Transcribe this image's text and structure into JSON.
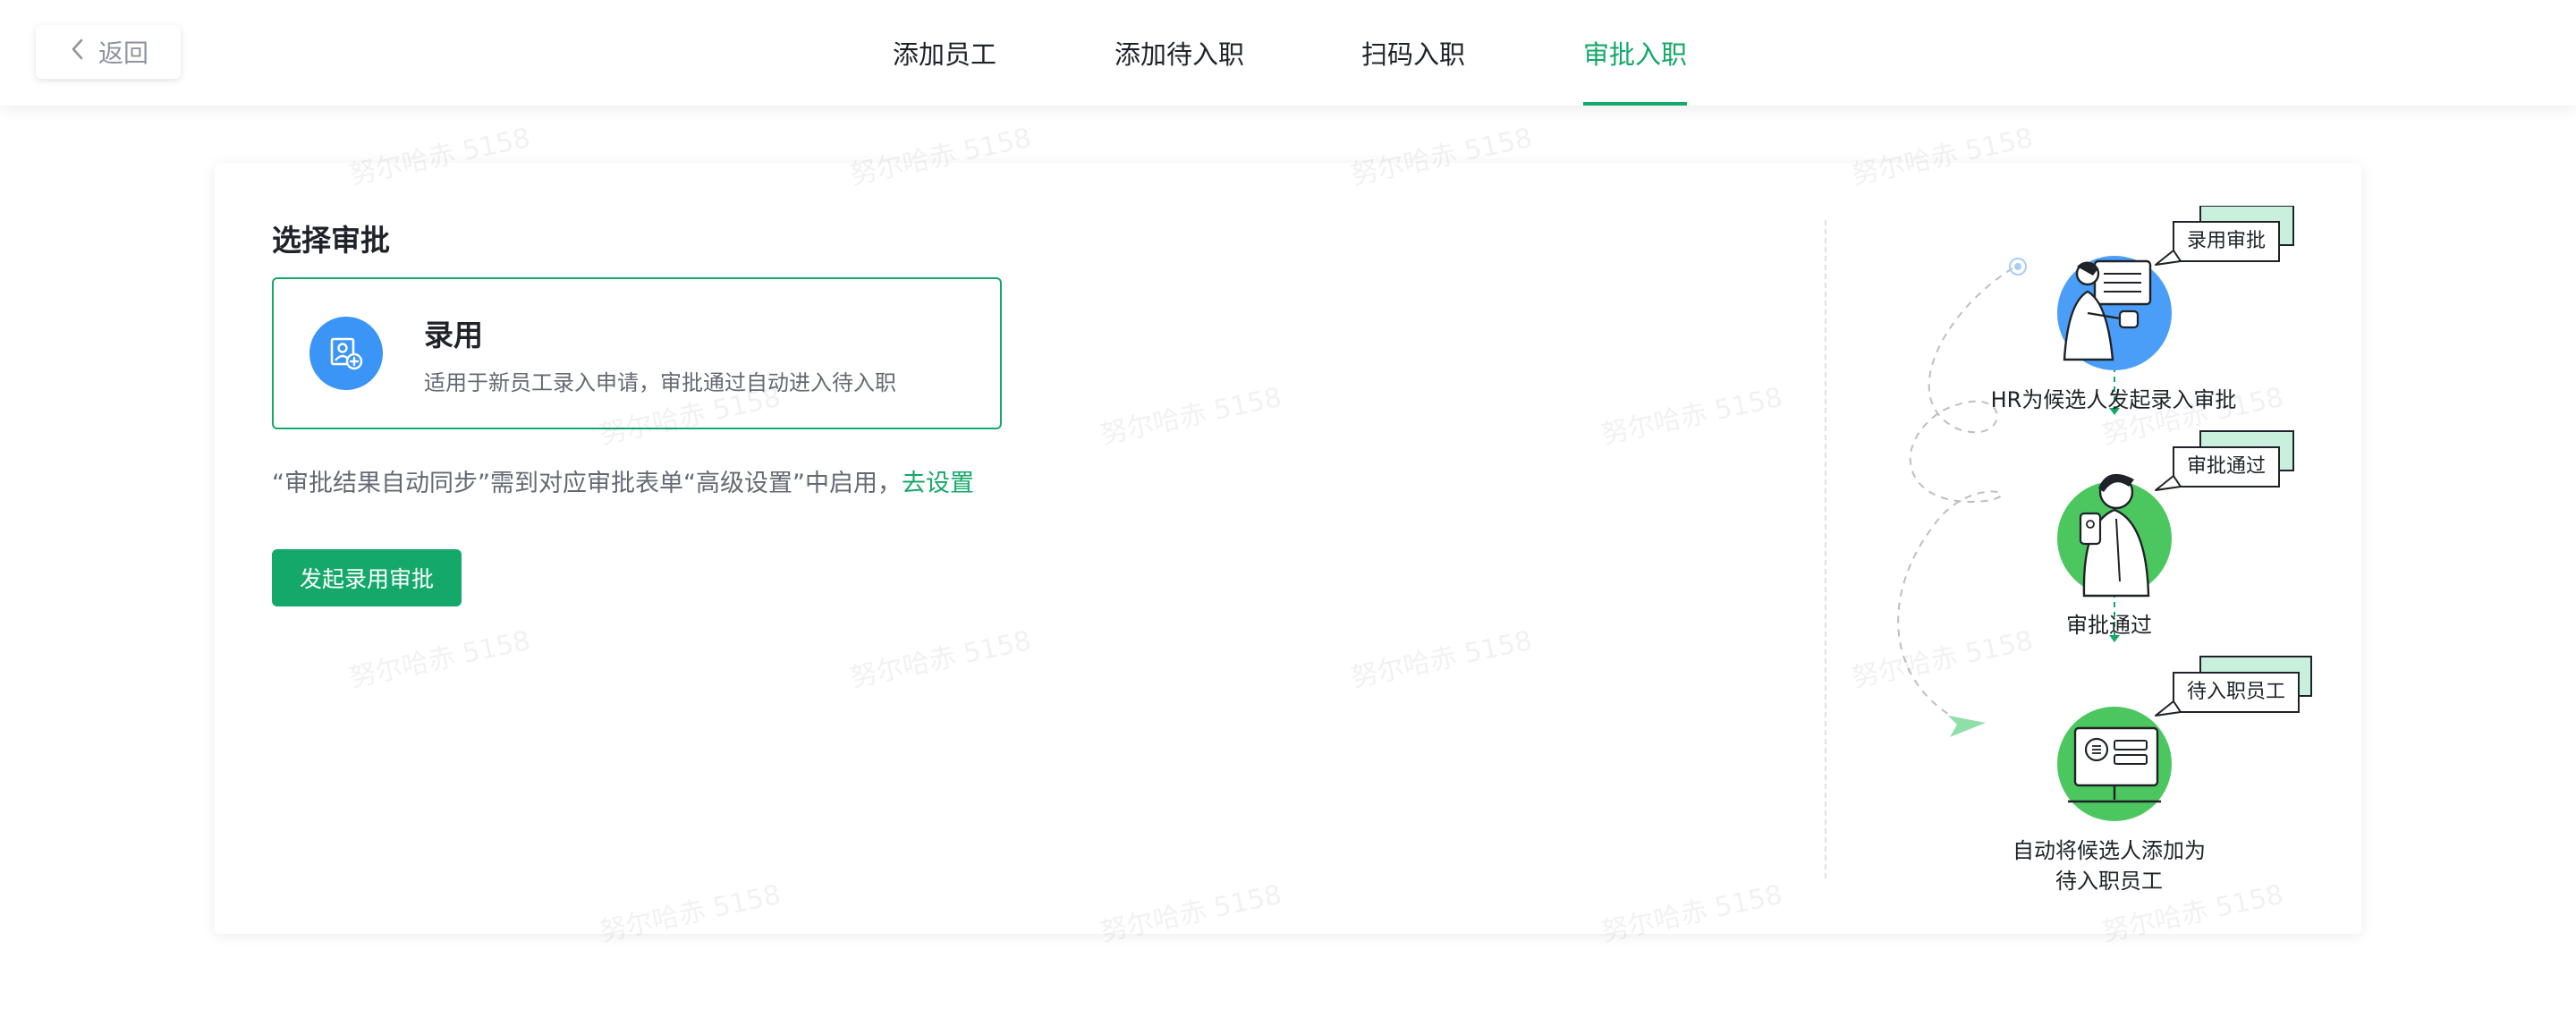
{
  "header": {
    "back_label": "返回",
    "tabs": [
      {
        "label": "添加员工",
        "active": false
      },
      {
        "label": "添加待入职",
        "active": false
      },
      {
        "label": "扫码入职",
        "active": false
      },
      {
        "label": "审批入职",
        "active": true
      }
    ]
  },
  "main": {
    "section_title": "选择审批",
    "option": {
      "title": "录用",
      "description": "适用于新员工录入申请，审批通过自动进入待入职",
      "icon": "user-add-icon"
    },
    "sync_note": "“审批结果自动同步”需到对应审批表单“高级设置”中启用，",
    "sync_link": "去设置",
    "submit_label": "发起录用审批"
  },
  "flow": {
    "steps": [
      {
        "bubble": "录用审批",
        "label": "HR为候选人发起录入审批"
      },
      {
        "bubble": "审批通过",
        "label": "审批通过"
      },
      {
        "bubble": "待入职员工",
        "label_line1": "自动将候选人添加为",
        "label_line2": "待入职员工"
      }
    ]
  },
  "watermark_text": "努尔哈赤 5158",
  "colors": {
    "accent": "#14a86a",
    "icon_blue": "#3b95f7",
    "illustration_green": "#4cc75f",
    "illustration_blue": "#4a9ef7"
  }
}
